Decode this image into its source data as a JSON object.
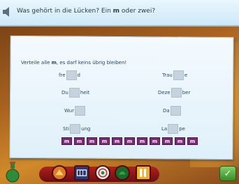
{
  "header": {
    "question_prefix": "Was gehört in die Lücken? Ein ",
    "question_bold": "m",
    "question_suffix": " oder zwei?"
  },
  "task": {
    "instruction_prefix": "Verteile alle ",
    "instruction_bold": "m",
    "instruction_suffix": ", es darf keins übrig bleiben!"
  },
  "words": [
    {
      "prefix": "fre",
      "suffix": "d"
    },
    {
      "prefix": "Trau",
      "suffix": "e"
    },
    {
      "prefix": "Du",
      "suffix": "heit"
    },
    {
      "prefix": "Deze",
      "suffix": "ber"
    },
    {
      "prefix": "Wur",
      "suffix": ""
    },
    {
      "prefix": "Da",
      "suffix": ""
    },
    {
      "prefix": "Sti",
      "suffix": "ung"
    },
    {
      "prefix": "La",
      "suffix": "pe"
    }
  ],
  "tiles": [
    "m",
    "m",
    "m",
    "m",
    "m",
    "m",
    "m",
    "m",
    "m",
    "m",
    "m"
  ],
  "toolbar": {
    "buttons": [
      "hat-icon",
      "abacus-icon",
      "target-icon",
      "cap-icon",
      "ruler-icon"
    ],
    "check": "✓"
  },
  "colors": {
    "tile": "#7a2d74",
    "banner": "#e3f3fc",
    "paper": "#eef7fd"
  }
}
